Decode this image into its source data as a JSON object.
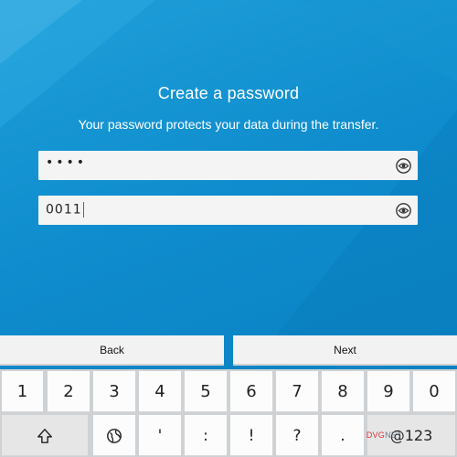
{
  "header": {
    "title": "Create a password",
    "subtitle": "Your password protects your data during the transfer."
  },
  "fields": {
    "password": {
      "value": "••••",
      "masked": true,
      "icon": "eye-icon"
    },
    "confirm": {
      "value": "0011",
      "masked": false,
      "icon": "eye-icon"
    }
  },
  "nav": {
    "back_label": "Back",
    "next_label": "Next"
  },
  "keyboard": {
    "row1": [
      "1",
      "2",
      "3",
      "4",
      "5",
      "6",
      "7",
      "8",
      "9",
      "0"
    ],
    "row2": {
      "shift_icon": "shift-icon",
      "globe_icon": "globe-icon",
      "keys": [
        "'",
        ":",
        "!",
        "?",
        "."
      ],
      "mode_label": "@123"
    }
  },
  "watermark": {
    "red": "DVG",
    "text": "NET"
  },
  "colors": {
    "background": "#0e8ccd",
    "field": "#f4f4f4",
    "keyboard": "#cfd2d4",
    "cursor": "#0a7ebf"
  }
}
